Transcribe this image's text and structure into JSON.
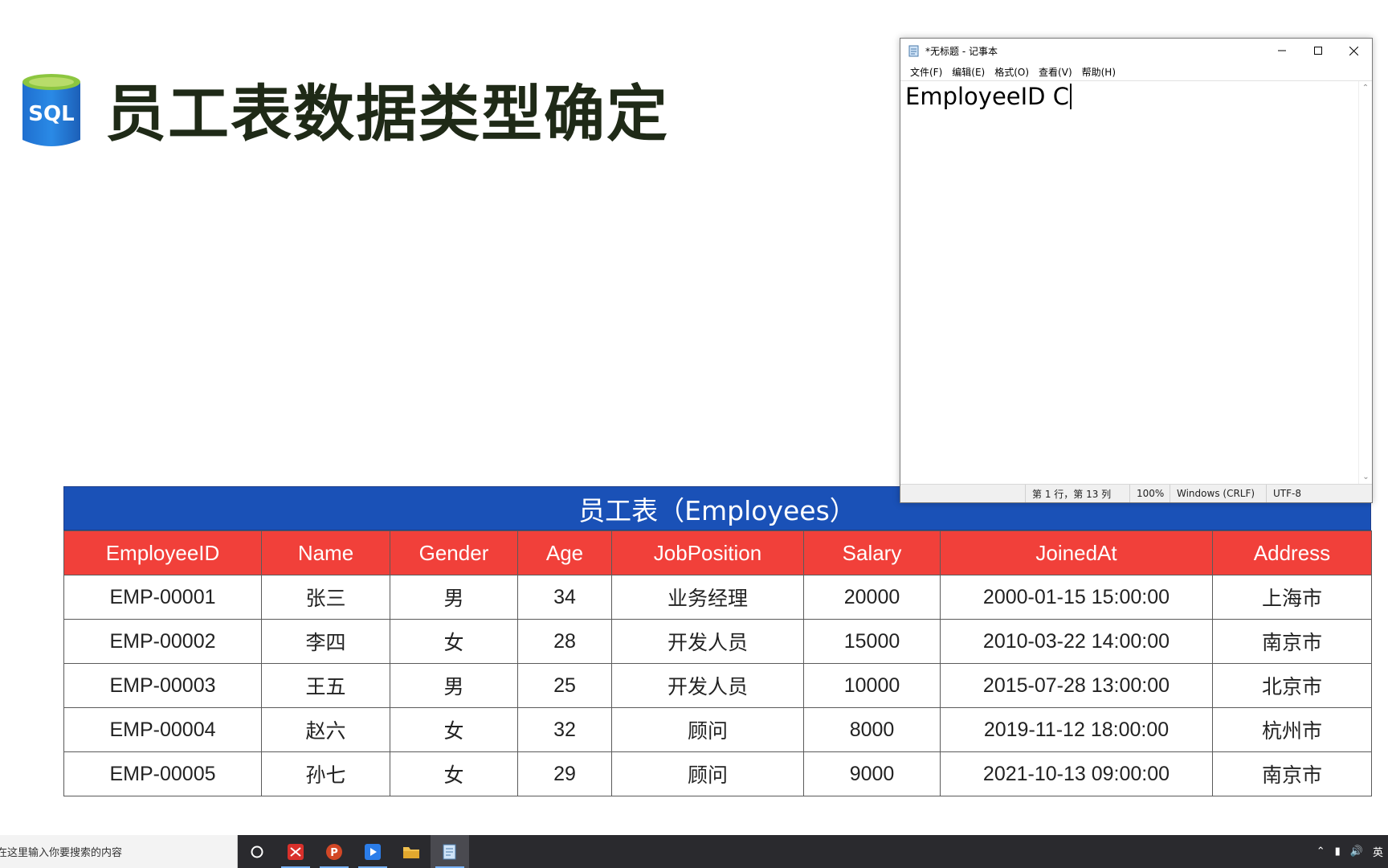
{
  "slide": {
    "logo_text": "SQL",
    "title": "员工表数据类型确定"
  },
  "table": {
    "caption": "员工表（Employees）",
    "columns": [
      "EmployeeID",
      "Name",
      "Gender",
      "Age",
      "JobPosition",
      "Salary",
      "JoinedAt",
      "Address"
    ],
    "rows": [
      [
        "EMP-00001",
        "张三",
        "男",
        "34",
        "业务经理",
        "20000",
        "2000-01-15 15:00:00",
        "上海市"
      ],
      [
        "EMP-00002",
        "李四",
        "女",
        "28",
        "开发人员",
        "15000",
        "2010-03-22 14:00:00",
        "南京市"
      ],
      [
        "EMP-00003",
        "王五",
        "男",
        "25",
        "开发人员",
        "10000",
        "2015-07-28 13:00:00",
        "北京市"
      ],
      [
        "EMP-00004",
        "赵六",
        "女",
        "32",
        "顾问",
        "8000",
        "2019-11-12 18:00:00",
        "杭州市"
      ],
      [
        "EMP-00005",
        "孙七",
        "女",
        "29",
        "顾问",
        "9000",
        "2021-10-13 09:00:00",
        "南京市"
      ]
    ]
  },
  "notepad": {
    "title": "*无标题 - 记事本",
    "menu": [
      "文件(F)",
      "编辑(E)",
      "格式(O)",
      "查看(V)",
      "帮助(H)"
    ],
    "content": "EmployeeID C",
    "status": {
      "position": "第 1 行，第 13 列",
      "zoom": "100%",
      "line_ending": "Windows (CRLF)",
      "encoding": "UTF-8"
    }
  },
  "taskbar": {
    "search_placeholder": "在这里输入你要搜索的内容",
    "tray_lang": "英"
  },
  "colors": {
    "caption_bg": "#1a51b7",
    "header_bg": "#f1403a",
    "title_color": "#1f2a17"
  }
}
